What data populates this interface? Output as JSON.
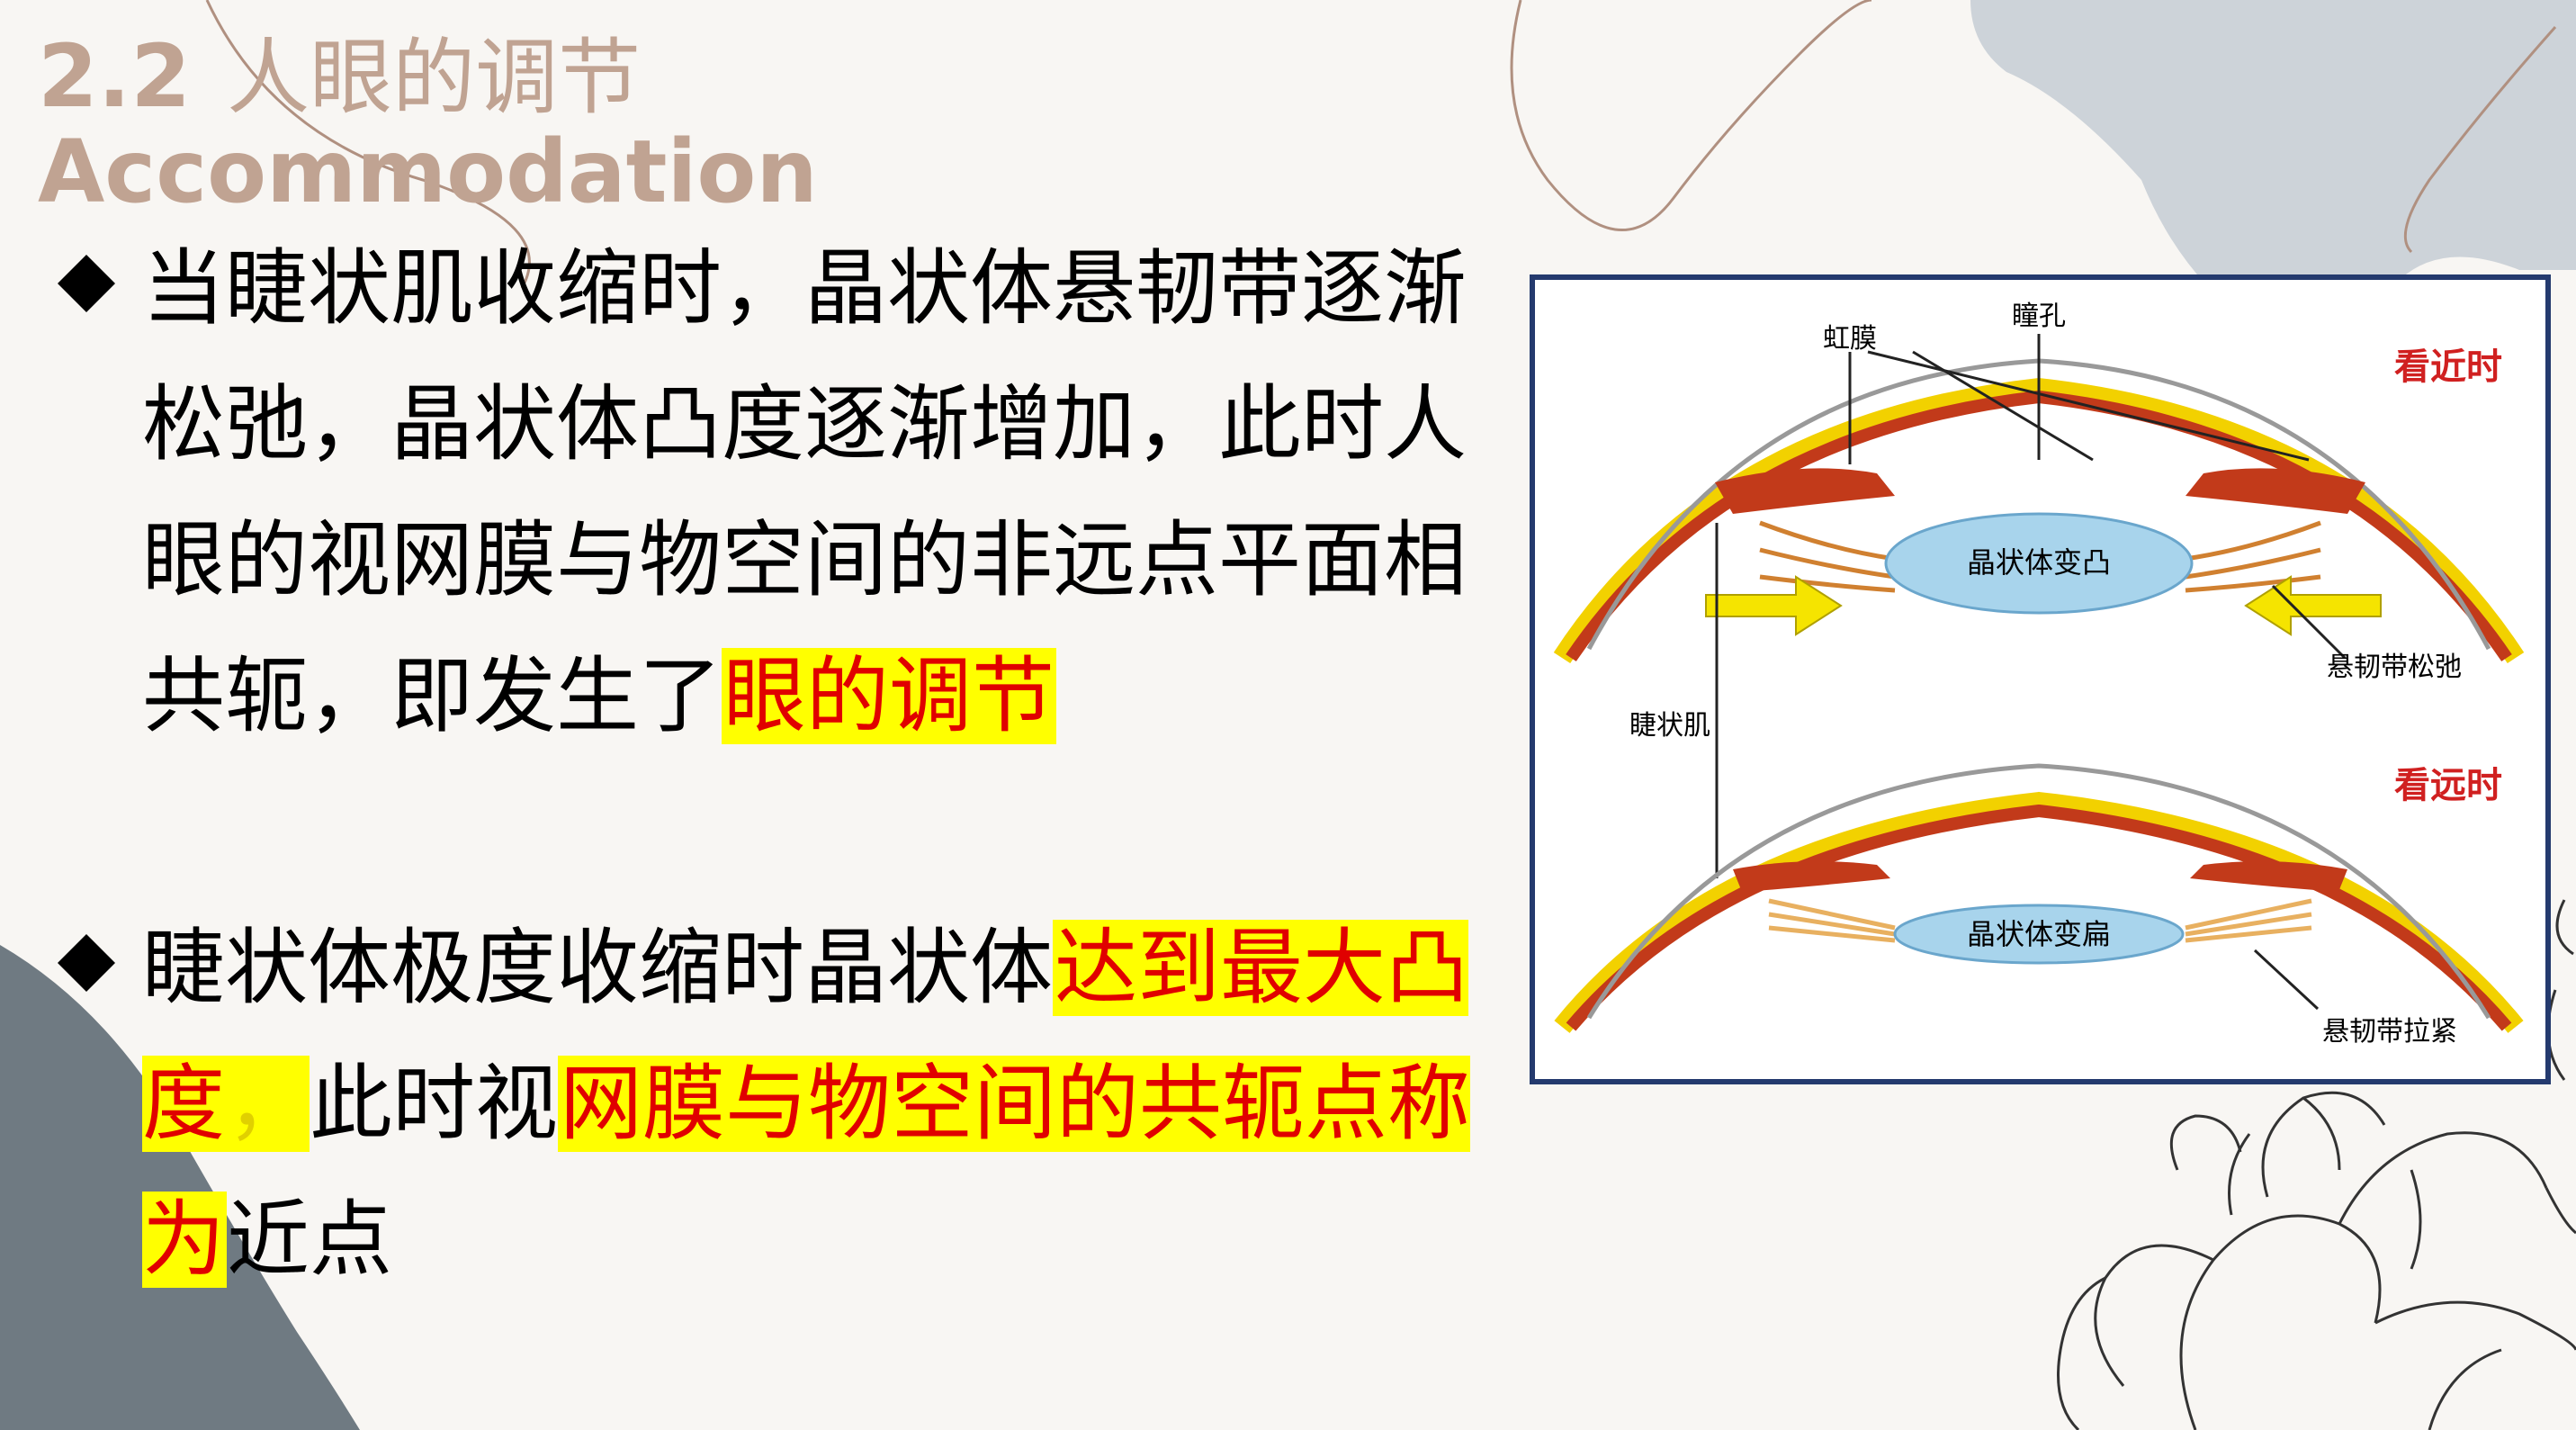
{
  "slide": {
    "title_number": "2.2",
    "title_zh": "人眼的调节",
    "title_en": "Accommodation",
    "colors": {
      "title": "#c0a392",
      "highlight_bg": "#ffff00",
      "highlight_text": "#e00000",
      "figure_border": "#243a6e",
      "dark_shape": "#6f7a82",
      "light_blue_shape": "#cdd3d9"
    },
    "bullets": [
      {
        "text_plain": "当睫状肌收缩时，晶状体悬韧带逐渐松弛，晶状体凸度逐渐增加，此时人眼的视网膜与物空间的非远点平面相共轭，即发生了",
        "text_highlight": "眼的调节"
      },
      {
        "text_plain_1": "睫状体极度收缩时晶状体",
        "text_highlight_1": "达到最大凸度",
        "text_highlight_gap": "，",
        "text_plain_2": "此时视",
        "text_highlight_2": "网膜与物空间的共轭点称为",
        "text_plain_3": "近点"
      }
    ],
    "figure": {
      "label_iris": "虹膜",
      "label_pupil": "瞳孔",
      "label_near": "看近时",
      "label_lens_convex": "晶状体变凸",
      "label_zonule_relaxed": "悬韧带松弛",
      "label_ciliary": "睫状肌",
      "label_far": "看远时",
      "label_lens_flat": "晶状体变扁",
      "label_zonule_tight": "悬韧带拉紧"
    }
  }
}
